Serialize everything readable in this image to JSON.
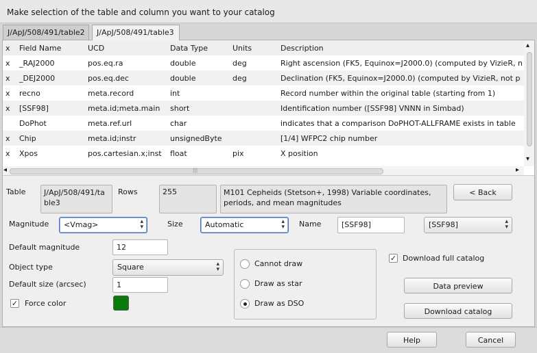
{
  "title": "Make selection of the table and column you want to your catalog",
  "tabs": [
    {
      "label": "J/ApJ/508/491/table2"
    },
    {
      "label": "J/ApJ/508/491/table3"
    }
  ],
  "columns": {
    "sel": "x",
    "field_name": "Field Name",
    "ucd": "UCD",
    "data_type": "Data Type",
    "units": "Units",
    "description": "Description"
  },
  "rows": [
    {
      "sel": "x",
      "name": "_RAJ2000",
      "ucd": "pos.eq.ra",
      "type": "double",
      "units": "deg",
      "desc": "Right ascension (FK5, Equinox=J2000.0) (computed by VizieR, n"
    },
    {
      "sel": "x",
      "name": "_DEJ2000",
      "ucd": "pos.eq.dec",
      "type": "double",
      "units": "deg",
      "desc": "Declination (FK5, Equinox=J2000.0) (computed by VizieR, not p"
    },
    {
      "sel": "x",
      "name": "recno",
      "ucd": "meta.record",
      "type": "int",
      "units": "",
      "desc": "Record number within the original table (starting from 1)"
    },
    {
      "sel": "x",
      "name": "[SSF98]",
      "ucd": "meta.id;meta.main",
      "type": "short",
      "units": "",
      "desc": "Identification number ([SSF98] VNNN in Simbad)"
    },
    {
      "sel": "",
      "name": "DoPhot",
      "ucd": "meta.ref.url",
      "type": "char",
      "units": "",
      "desc": "indicates that a comparison DoPHOT-ALLFRAME exists in table"
    },
    {
      "sel": "x",
      "name": "Chip",
      "ucd": "meta.id;instr",
      "type": "unsignedByte",
      "units": "",
      "desc": "[1/4] WFPC2 chip number"
    },
    {
      "sel": "x",
      "name": "Xpos",
      "ucd": "pos.cartesian.x;inst",
      "type": "float",
      "units": "pix",
      "desc": "X position"
    }
  ],
  "scroll": {
    "left_arrow": "◂",
    "right_arrow": "▸",
    "up_arrow": "▴",
    "down_arrow": "▾",
    "grip": "|||"
  },
  "info": {
    "table_label": "Table",
    "table_value": "J/ApJ/508/491/table3",
    "rows_label": "Rows",
    "rows_value": "255",
    "description": "M101 Cepheids (Stetson+, 1998) Variable coordinates, periods, and mean magnitudes",
    "back_button": "< Back"
  },
  "magnitude": {
    "label": "Magnitude",
    "value": "<Vmag>"
  },
  "size": {
    "label": "Size",
    "value": "Automatic"
  },
  "name": {
    "label": "Name",
    "value": "[SSF98]",
    "select_value": "[SSF98]"
  },
  "default_magnitude": {
    "label": "Default magnitude",
    "value": "12"
  },
  "object_type": {
    "label": "Object type",
    "value": "Square"
  },
  "default_size": {
    "label": "Default size (arcsec)",
    "value": "1"
  },
  "force_color": {
    "label": "Force color",
    "checked": true,
    "color": "#0a7a0a"
  },
  "draw_options": [
    {
      "label": "Cannot draw",
      "selected": false
    },
    {
      "label": "Draw as star",
      "selected": false
    },
    {
      "label": "Draw as DSO",
      "selected": true
    }
  ],
  "download_full": {
    "label": "Download full catalog",
    "checked": true
  },
  "data_preview_button": "Data preview",
  "download_catalog_button": "Download catalog",
  "help_button": "Help",
  "cancel_button": "Cancel",
  "check_mark": "✓",
  "icons": {
    "combo_caret": "updown-arrows-icon"
  }
}
